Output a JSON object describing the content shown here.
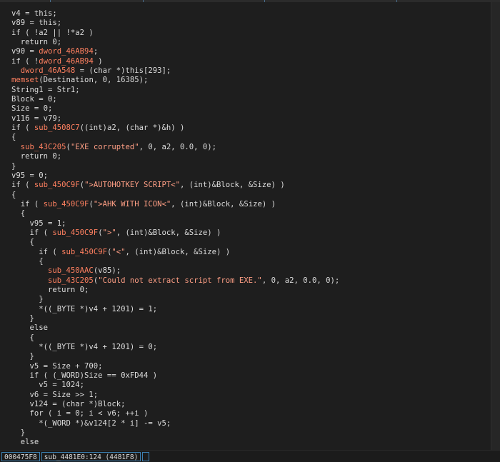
{
  "code_lines": [
    [
      {
        "t": "v4 = this;",
        "c": "kw"
      }
    ],
    [
      {
        "t": "v89 = this;",
        "c": "kw"
      }
    ],
    [
      {
        "t": "if ( !a2 || !*a2 )",
        "c": "kw"
      }
    ],
    [
      {
        "t": "  return 0;",
        "c": "kw"
      }
    ],
    [
      {
        "t": "v90 = ",
        "c": "kw"
      },
      {
        "t": "dword_46AB94",
        "c": "fn"
      },
      {
        "t": ";",
        "c": "kw"
      }
    ],
    [
      {
        "t": "if ( !",
        "c": "kw"
      },
      {
        "t": "dword_46AB94",
        "c": "fn"
      },
      {
        "t": " )",
        "c": "kw"
      }
    ],
    [
      {
        "t": "  ",
        "c": "kw"
      },
      {
        "t": "dword_46A548",
        "c": "fn"
      },
      {
        "t": " = (char *)this[293];",
        "c": "kw"
      }
    ],
    [
      {
        "t": "memset",
        "c": "fn"
      },
      {
        "t": "(Destination, 0, 16385);",
        "c": "kw"
      }
    ],
    [
      {
        "t": "String1 = Str1;",
        "c": "kw"
      }
    ],
    [
      {
        "t": "Block = 0;",
        "c": "kw"
      }
    ],
    [
      {
        "t": "Size = 0;",
        "c": "kw"
      }
    ],
    [
      {
        "t": "v116 = v79;",
        "c": "kw"
      }
    ],
    [
      {
        "t": "if ( ",
        "c": "kw"
      },
      {
        "t": "sub_4508C7",
        "c": "fn"
      },
      {
        "t": "((int)a2, (char *)&h) )",
        "c": "kw"
      }
    ],
    [
      {
        "t": "{",
        "c": "kw"
      }
    ],
    [
      {
        "t": "  ",
        "c": "kw"
      },
      {
        "t": "sub_43C205",
        "c": "fn"
      },
      {
        "t": "(",
        "c": "kw"
      },
      {
        "t": "\"EXE corrupted\"",
        "c": "str"
      },
      {
        "t": ", 0, a2, 0.0, 0);",
        "c": "kw"
      }
    ],
    [
      {
        "t": "  return 0;",
        "c": "kw"
      }
    ],
    [
      {
        "t": "}",
        "c": "kw"
      }
    ],
    [
      {
        "t": "v95 = 0;",
        "c": "kw"
      }
    ],
    [
      {
        "t": "if ( ",
        "c": "kw"
      },
      {
        "t": "sub_450C9F",
        "c": "fn"
      },
      {
        "t": "(",
        "c": "kw"
      },
      {
        "t": "\">AUTOHOTKEY SCRIPT<\"",
        "c": "str"
      },
      {
        "t": ", (int)&Block, &Size) )",
        "c": "kw"
      }
    ],
    [
      {
        "t": "{",
        "c": "kw"
      }
    ],
    [
      {
        "t": "  if ( ",
        "c": "kw"
      },
      {
        "t": "sub_450C9F",
        "c": "fn"
      },
      {
        "t": "(",
        "c": "kw"
      },
      {
        "t": "\">AHK WITH ICON<\"",
        "c": "str"
      },
      {
        "t": ", (int)&Block, &Size) )",
        "c": "kw"
      }
    ],
    [
      {
        "t": "  {",
        "c": "kw"
      }
    ],
    [
      {
        "t": "    v95 = 1;",
        "c": "kw"
      }
    ],
    [
      {
        "t": "    if ( ",
        "c": "kw"
      },
      {
        "t": "sub_450C9F",
        "c": "fn"
      },
      {
        "t": "(",
        "c": "kw"
      },
      {
        "t": "\">\"",
        "c": "str"
      },
      {
        "t": ", (int)&Block, &Size) )",
        "c": "kw"
      }
    ],
    [
      {
        "t": "    {",
        "c": "kw"
      }
    ],
    [
      {
        "t": "      if ( ",
        "c": "kw"
      },
      {
        "t": "sub_450C9F",
        "c": "fn"
      },
      {
        "t": "(",
        "c": "kw"
      },
      {
        "t": "\"<\"",
        "c": "str"
      },
      {
        "t": ", (int)&Block, &Size) )",
        "c": "kw"
      }
    ],
    [
      {
        "t": "      {",
        "c": "kw"
      }
    ],
    [
      {
        "t": "        ",
        "c": "kw"
      },
      {
        "t": "sub_450AAC",
        "c": "fn"
      },
      {
        "t": "(v85);",
        "c": "kw"
      }
    ],
    [
      {
        "t": "        ",
        "c": "kw"
      },
      {
        "t": "sub_43C205",
        "c": "fn"
      },
      {
        "t": "(",
        "c": "kw"
      },
      {
        "t": "\"Could not extract script from EXE.\"",
        "c": "str"
      },
      {
        "t": ", 0, a2, 0.0, 0);",
        "c": "kw"
      }
    ],
    [
      {
        "t": "        return 0;",
        "c": "kw"
      }
    ],
    [
      {
        "t": "      }",
        "c": "kw"
      }
    ],
    [
      {
        "t": "      *((_BYTE *)v4 + 1201) = 1;",
        "c": "kw"
      }
    ],
    [
      {
        "t": "    }",
        "c": "kw"
      }
    ],
    [
      {
        "t": "    else",
        "c": "kw"
      }
    ],
    [
      {
        "t": "    {",
        "c": "kw"
      }
    ],
    [
      {
        "t": "      *((_BYTE *)v4 + 1201) = 0;",
        "c": "kw"
      }
    ],
    [
      {
        "t": "    }",
        "c": "kw"
      }
    ],
    [
      {
        "t": "    v5 = Size + 700;",
        "c": "kw"
      }
    ],
    [
      {
        "t": "    if ( (_WORD)Size == 0xFD44 )",
        "c": "kw"
      }
    ],
    [
      {
        "t": "      v5 = 1024;",
        "c": "kw"
      }
    ],
    [
      {
        "t": "    v6 = Size >> 1;",
        "c": "kw"
      }
    ],
    [
      {
        "t": "    v124 = (char *)Block;",
        "c": "kw"
      }
    ],
    [
      {
        "t": "    for ( i = 0; i < v6; ++i )",
        "c": "kw"
      }
    ],
    [
      {
        "t": "      *(_WORD *)&v124[2 * i] -= v5;",
        "c": "kw"
      }
    ],
    [
      {
        "t": "  }",
        "c": "kw"
      }
    ],
    [
      {
        "t": "  else",
        "c": "kw"
      }
    ]
  ],
  "status": {
    "address": "000475F8",
    "location": "sub_4481E0:124 (4481F8)",
    "extra": ""
  },
  "colors": {
    "background": "#1e1e1e",
    "function_ref": "#ff8060",
    "string_literal": "#ff9f85",
    "text": "#dcdcdc",
    "status_border": "#3c7fb1"
  }
}
